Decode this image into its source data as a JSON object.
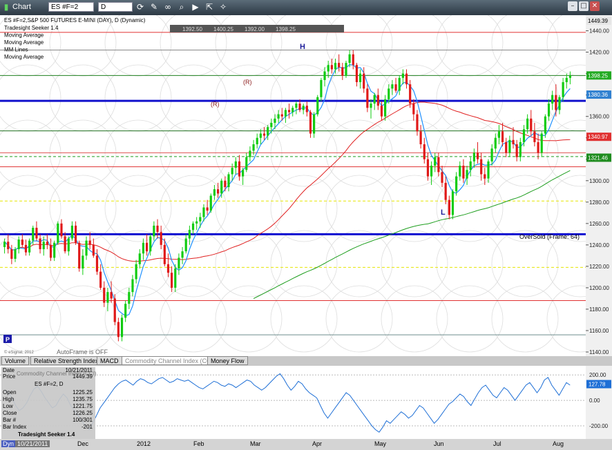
{
  "toolbar": {
    "title": "Chart",
    "symbol": "ES #F=2",
    "interval": "D"
  },
  "chart_title": "ES #F=2,S&P 500 FUTURES E-MINI (DAY), D (Dynamic)",
  "studies_legend": [
    "Tradesight Seeker 1.4",
    "Moving Average",
    "Moving Average",
    "MM Lines",
    "Moving Average"
  ],
  "ohlc_header": [
    "1392.50",
    "1400.25",
    "1392.00",
    "1398.25"
  ],
  "price_axis_labels": [
    "1440.00",
    "1420.00",
    "1400.00",
    "1380.00",
    "1360.00",
    "1340.00",
    "1320.00",
    "1300.00",
    "1280.00",
    "1260.00",
    "1240.00",
    "1220.00",
    "1200.00",
    "1180.00",
    "1160.00",
    "1140.00"
  ],
  "price_badges": [
    {
      "text": "1449.39",
      "color": "#e6e6e6",
      "text_color": "#000"
    },
    {
      "text": "1398.25",
      "color": "#22aa22",
      "text_color": "#fff"
    },
    {
      "text": "1380.36",
      "color": "#2f80d0",
      "text_color": "#fff"
    },
    {
      "text": "1340.97",
      "color": "#e03030",
      "text_color": "#fff"
    },
    {
      "text": "1321.46",
      "color": "#1e8c1e",
      "text_color": "#fff"
    }
  ],
  "annotations": {
    "oversold": "OverSold (Frame: 64)",
    "autoframe": "AutoFrame is OFF",
    "copyright": "© eSignal, 2012",
    "p_marker": "P",
    "high_marker": "H",
    "low_marker": "L",
    "r_labels": [
      "(R)",
      "(R)"
    ]
  },
  "indicator_tabs": [
    "Volume",
    "Relative Strength Index",
    "MACD",
    "Commodity Channel Index (CCI)",
    "Money Flow"
  ],
  "cci_axis_labels": [
    "200.00",
    "0.00",
    "-200.00"
  ],
  "cci_badge": "127.78",
  "info_panel": {
    "date_label": "Date",
    "date_value": "10/21/2011",
    "price_label": "Price",
    "price_value": "1449.39",
    "cci_title": "Commodity Channel Index (CCI)",
    "symbol": "ES #F=2, D",
    "rows": [
      {
        "label": "Open",
        "value": "1225.25"
      },
      {
        "label": "High",
        "value": "1235.75"
      },
      {
        "label": "Low",
        "value": "1221.75"
      },
      {
        "label": "Close",
        "value": "1226.25"
      },
      {
        "label": "Bar #",
        "value": "100/301"
      },
      {
        "label": "Bar Index",
        "value": "-201"
      }
    ],
    "study": "Tradesight Seeker 1.4"
  },
  "time_axis_labels": [
    "Dec",
    "2012",
    "Feb",
    "Mar",
    "Apr",
    "May",
    "Jun",
    "Jul",
    "Aug"
  ],
  "dyn_label": "Dyn",
  "date_cursor": "10/21/2011",
  "colors": {
    "up": "#11cc11",
    "down": "#e01818",
    "ma_fast": "#1e90ff",
    "ma_slow": "#e02020",
    "ma_200": "#1e9e1e",
    "axis_bg": "#f0f0f0"
  },
  "chart_data": {
    "type": "candlestick",
    "price_ylim": [
      1140,
      1449.39
    ],
    "cci_ylim": [
      -260,
      250
    ],
    "horizontal_levels": [
      {
        "price": 1438.5,
        "color": "#e03030",
        "style": "solid"
      },
      {
        "price": 1422.0,
        "color": "#888888",
        "style": "solid"
      },
      {
        "price": 1398.25,
        "color": "#1e7f1e",
        "style": "solid"
      },
      {
        "price": 1374.5,
        "color": "#1010cc",
        "style": "thick"
      },
      {
        "price": 1346.5,
        "color": "#1e6f1e",
        "style": "solid"
      },
      {
        "price": 1326.0,
        "color": "#e05050",
        "style": "solid"
      },
      {
        "price": 1322.5,
        "color": "#1e9e1e",
        "style": "dashed"
      },
      {
        "price": 1313.0,
        "color": "#e03030",
        "style": "solid"
      },
      {
        "price": 1281.0,
        "color": "#e6e600",
        "style": "dashed"
      },
      {
        "price": 1250.0,
        "color": "#0a0ad0",
        "style": "thick"
      },
      {
        "price": 1219.0,
        "color": "#e6e600",
        "style": "dashed"
      },
      {
        "price": 1188.0,
        "color": "#e03030",
        "style": "solid"
      },
      {
        "price": 1156.0,
        "color": "#6e8e8e",
        "style": "solid"
      }
    ],
    "candles": [
      [
        1238,
        1246,
        1232,
        1243
      ],
      [
        1243,
        1250,
        1232,
        1236
      ],
      [
        1236,
        1240,
        1222,
        1227
      ],
      [
        1227,
        1238,
        1224,
        1236
      ],
      [
        1236,
        1248,
        1232,
        1245
      ],
      [
        1245,
        1250,
        1238,
        1240
      ],
      [
        1240,
        1245,
        1230,
        1233
      ],
      [
        1233,
        1246,
        1230,
        1244
      ],
      [
        1244,
        1258,
        1240,
        1256
      ],
      [
        1256,
        1262,
        1244,
        1246
      ],
      [
        1246,
        1250,
        1232,
        1236
      ],
      [
        1236,
        1248,
        1230,
        1243
      ],
      [
        1243,
        1250,
        1236,
        1240
      ],
      [
        1240,
        1246,
        1225,
        1228
      ],
      [
        1228,
        1244,
        1225,
        1242
      ],
      [
        1242,
        1262,
        1240,
        1260
      ],
      [
        1260,
        1264,
        1246,
        1248
      ],
      [
        1248,
        1252,
        1232,
        1234
      ],
      [
        1234,
        1248,
        1230,
        1246
      ],
      [
        1246,
        1262,
        1244,
        1258
      ],
      [
        1258,
        1262,
        1240,
        1242
      ],
      [
        1242,
        1244,
        1215,
        1218
      ],
      [
        1218,
        1236,
        1212,
        1230
      ],
      [
        1230,
        1248,
        1226,
        1244
      ],
      [
        1244,
        1252,
        1236,
        1240
      ],
      [
        1240,
        1246,
        1228,
        1230
      ],
      [
        1230,
        1236,
        1212,
        1215
      ],
      [
        1215,
        1222,
        1198,
        1200
      ],
      [
        1200,
        1206,
        1182,
        1186
      ],
      [
        1186,
        1200,
        1178,
        1196
      ],
      [
        1196,
        1206,
        1186,
        1190
      ],
      [
        1190,
        1194,
        1165,
        1168
      ],
      [
        1168,
        1172,
        1150,
        1154
      ],
      [
        1154,
        1175,
        1150,
        1172
      ],
      [
        1172,
        1188,
        1168,
        1185
      ],
      [
        1185,
        1200,
        1180,
        1196
      ],
      [
        1196,
        1212,
        1192,
        1208
      ],
      [
        1208,
        1226,
        1204,
        1222
      ],
      [
        1222,
        1236,
        1218,
        1232
      ],
      [
        1232,
        1246,
        1226,
        1242
      ],
      [
        1242,
        1250,
        1230,
        1234
      ],
      [
        1234,
        1250,
        1230,
        1248
      ],
      [
        1248,
        1262,
        1244,
        1258
      ],
      [
        1258,
        1264,
        1246,
        1252
      ],
      [
        1252,
        1258,
        1236,
        1240
      ],
      [
        1240,
        1246,
        1220,
        1222
      ],
      [
        1222,
        1232,
        1210,
        1214
      ],
      [
        1214,
        1220,
        1196,
        1200
      ],
      [
        1200,
        1222,
        1196,
        1218
      ],
      [
        1218,
        1232,
        1212,
        1228
      ],
      [
        1228,
        1238,
        1222,
        1234
      ],
      [
        1234,
        1250,
        1232,
        1246
      ],
      [
        1246,
        1258,
        1240,
        1254
      ],
      [
        1254,
        1262,
        1250,
        1260
      ],
      [
        1260,
        1266,
        1254,
        1262
      ],
      [
        1262,
        1270,
        1256,
        1266
      ],
      [
        1266,
        1278,
        1262,
        1275
      ],
      [
        1275,
        1282,
        1268,
        1272
      ],
      [
        1272,
        1288,
        1270,
        1286
      ],
      [
        1286,
        1296,
        1282,
        1292
      ],
      [
        1292,
        1298,
        1284,
        1288
      ],
      [
        1288,
        1302,
        1284,
        1300
      ],
      [
        1300,
        1304,
        1290,
        1294
      ],
      [
        1294,
        1308,
        1290,
        1306
      ],
      [
        1306,
        1316,
        1300,
        1312
      ],
      [
        1312,
        1322,
        1306,
        1318
      ],
      [
        1318,
        1324,
        1300,
        1304
      ],
      [
        1304,
        1312,
        1296,
        1310
      ],
      [
        1310,
        1326,
        1308,
        1322
      ],
      [
        1322,
        1332,
        1318,
        1328
      ],
      [
        1328,
        1338,
        1324,
        1334
      ],
      [
        1334,
        1344,
        1330,
        1340
      ],
      [
        1340,
        1348,
        1334,
        1344
      ],
      [
        1344,
        1350,
        1338,
        1342
      ],
      [
        1342,
        1352,
        1338,
        1350
      ],
      [
        1350,
        1358,
        1344,
        1354
      ],
      [
        1354,
        1362,
        1348,
        1358
      ],
      [
        1358,
        1366,
        1354,
        1362
      ],
      [
        1362,
        1368,
        1356,
        1360
      ],
      [
        1360,
        1368,
        1354,
        1366
      ],
      [
        1366,
        1372,
        1358,
        1364
      ],
      [
        1364,
        1370,
        1360,
        1368
      ],
      [
        1368,
        1374,
        1362,
        1372
      ],
      [
        1372,
        1376,
        1364,
        1366
      ],
      [
        1366,
        1372,
        1362,
        1370
      ],
      [
        1370,
        1374,
        1360,
        1364
      ],
      [
        1364,
        1366,
        1340,
        1344
      ],
      [
        1344,
        1364,
        1340,
        1362
      ],
      [
        1362,
        1380,
        1360,
        1378
      ],
      [
        1378,
        1396,
        1374,
        1394
      ],
      [
        1394,
        1406,
        1388,
        1402
      ],
      [
        1402,
        1412,
        1396,
        1408
      ],
      [
        1408,
        1414,
        1400,
        1404
      ],
      [
        1404,
        1414,
        1400,
        1410
      ],
      [
        1410,
        1418,
        1402,
        1406
      ],
      [
        1406,
        1410,
        1394,
        1398
      ],
      [
        1398,
        1412,
        1396,
        1410
      ],
      [
        1410,
        1422,
        1406,
        1418
      ],
      [
        1418,
        1422,
        1404,
        1408
      ],
      [
        1408,
        1410,
        1388,
        1392
      ],
      [
        1392,
        1404,
        1386,
        1400
      ],
      [
        1400,
        1406,
        1382,
        1386
      ],
      [
        1386,
        1390,
        1364,
        1368
      ],
      [
        1368,
        1376,
        1358,
        1372
      ],
      [
        1372,
        1382,
        1366,
        1380
      ],
      [
        1380,
        1386,
        1366,
        1370
      ],
      [
        1370,
        1374,
        1356,
        1360
      ],
      [
        1360,
        1380,
        1356,
        1376
      ],
      [
        1376,
        1390,
        1372,
        1386
      ],
      [
        1386,
        1394,
        1380,
        1390
      ],
      [
        1390,
        1396,
        1382,
        1384
      ],
      [
        1384,
        1398,
        1380,
        1396
      ],
      [
        1396,
        1404,
        1390,
        1400
      ],
      [
        1400,
        1404,
        1386,
        1390
      ],
      [
        1390,
        1394,
        1368,
        1372
      ],
      [
        1372,
        1376,
        1356,
        1362
      ],
      [
        1362,
        1366,
        1342,
        1346
      ],
      [
        1346,
        1352,
        1330,
        1334
      ],
      [
        1334,
        1340,
        1316,
        1320
      ],
      [
        1320,
        1326,
        1300,
        1304
      ],
      [
        1304,
        1318,
        1296,
        1314
      ],
      [
        1314,
        1326,
        1308,
        1322
      ],
      [
        1322,
        1326,
        1304,
        1308
      ],
      [
        1308,
        1314,
        1294,
        1298
      ],
      [
        1298,
        1304,
        1278,
        1282
      ],
      [
        1282,
        1286,
        1264,
        1268
      ],
      [
        1268,
        1292,
        1264,
        1290
      ],
      [
        1290,
        1308,
        1286,
        1304
      ],
      [
        1304,
        1318,
        1300,
        1314
      ],
      [
        1314,
        1320,
        1298,
        1302
      ],
      [
        1302,
        1314,
        1296,
        1310
      ],
      [
        1310,
        1322,
        1304,
        1318
      ],
      [
        1318,
        1330,
        1312,
        1326
      ],
      [
        1326,
        1336,
        1316,
        1320
      ],
      [
        1320,
        1326,
        1300,
        1306
      ],
      [
        1306,
        1312,
        1296,
        1302
      ],
      [
        1302,
        1320,
        1298,
        1318
      ],
      [
        1318,
        1334,
        1314,
        1330
      ],
      [
        1330,
        1344,
        1326,
        1340
      ],
      [
        1340,
        1352,
        1334,
        1346
      ],
      [
        1346,
        1354,
        1332,
        1336
      ],
      [
        1336,
        1340,
        1322,
        1326
      ],
      [
        1326,
        1342,
        1322,
        1338
      ],
      [
        1338,
        1350,
        1330,
        1334
      ],
      [
        1334,
        1338,
        1318,
        1322
      ],
      [
        1322,
        1340,
        1318,
        1336
      ],
      [
        1336,
        1352,
        1332,
        1348
      ],
      [
        1348,
        1362,
        1344,
        1358
      ],
      [
        1358,
        1366,
        1342,
        1346
      ],
      [
        1346,
        1354,
        1332,
        1336
      ],
      [
        1336,
        1344,
        1320,
        1326
      ],
      [
        1326,
        1346,
        1322,
        1344
      ],
      [
        1344,
        1362,
        1340,
        1360
      ],
      [
        1360,
        1376,
        1356,
        1372
      ],
      [
        1372,
        1384,
        1366,
        1380
      ],
      [
        1380,
        1390,
        1360,
        1366
      ],
      [
        1366,
        1380,
        1362,
        1378
      ],
      [
        1378,
        1396,
        1374,
        1392
      ],
      [
        1392,
        1400,
        1386,
        1396
      ],
      [
        1396,
        1402,
        1390,
        1398
      ]
    ],
    "cci": [
      80,
      60,
      20,
      -40,
      -80,
      -60,
      -20,
      40,
      90,
      110,
      70,
      20,
      -20,
      -60,
      -40,
      10,
      50,
      20,
      -40,
      -80,
      -120,
      -160,
      -200,
      -230,
      -180,
      -120,
      -60,
      -20,
      20,
      60,
      100,
      130,
      150,
      160,
      140,
      120,
      150,
      170,
      160,
      140,
      130,
      150,
      170,
      180,
      160,
      140,
      150,
      170,
      160,
      150,
      160,
      140,
      120,
      100,
      90,
      110,
      130,
      150,
      140,
      120,
      110,
      130,
      120,
      100,
      120,
      140,
      160,
      150,
      120,
      100,
      80,
      100,
      130,
      160,
      190,
      210,
      170,
      120,
      80,
      110,
      150,
      130,
      90,
      60,
      40,
      20,
      -40,
      -100,
      -140,
      -100,
      -60,
      -20,
      20,
      60,
      40,
      0,
      -40,
      -80,
      -120,
      -160,
      -200,
      -230,
      -250,
      -210,
      -160,
      -180,
      -150,
      -120,
      -90,
      -110,
      -140,
      -120,
      -80,
      -40,
      -60,
      -100,
      -140,
      -180,
      -150,
      -110,
      -70,
      -30,
      -10,
      20,
      50,
      30,
      -10,
      -40,
      10,
      60,
      100,
      120,
      80,
      40,
      20,
      60,
      100,
      80,
      40,
      0,
      40,
      80,
      120,
      140,
      100,
      60,
      100,
      160,
      180,
      120,
      80,
      40,
      90,
      140,
      120
    ]
  }
}
